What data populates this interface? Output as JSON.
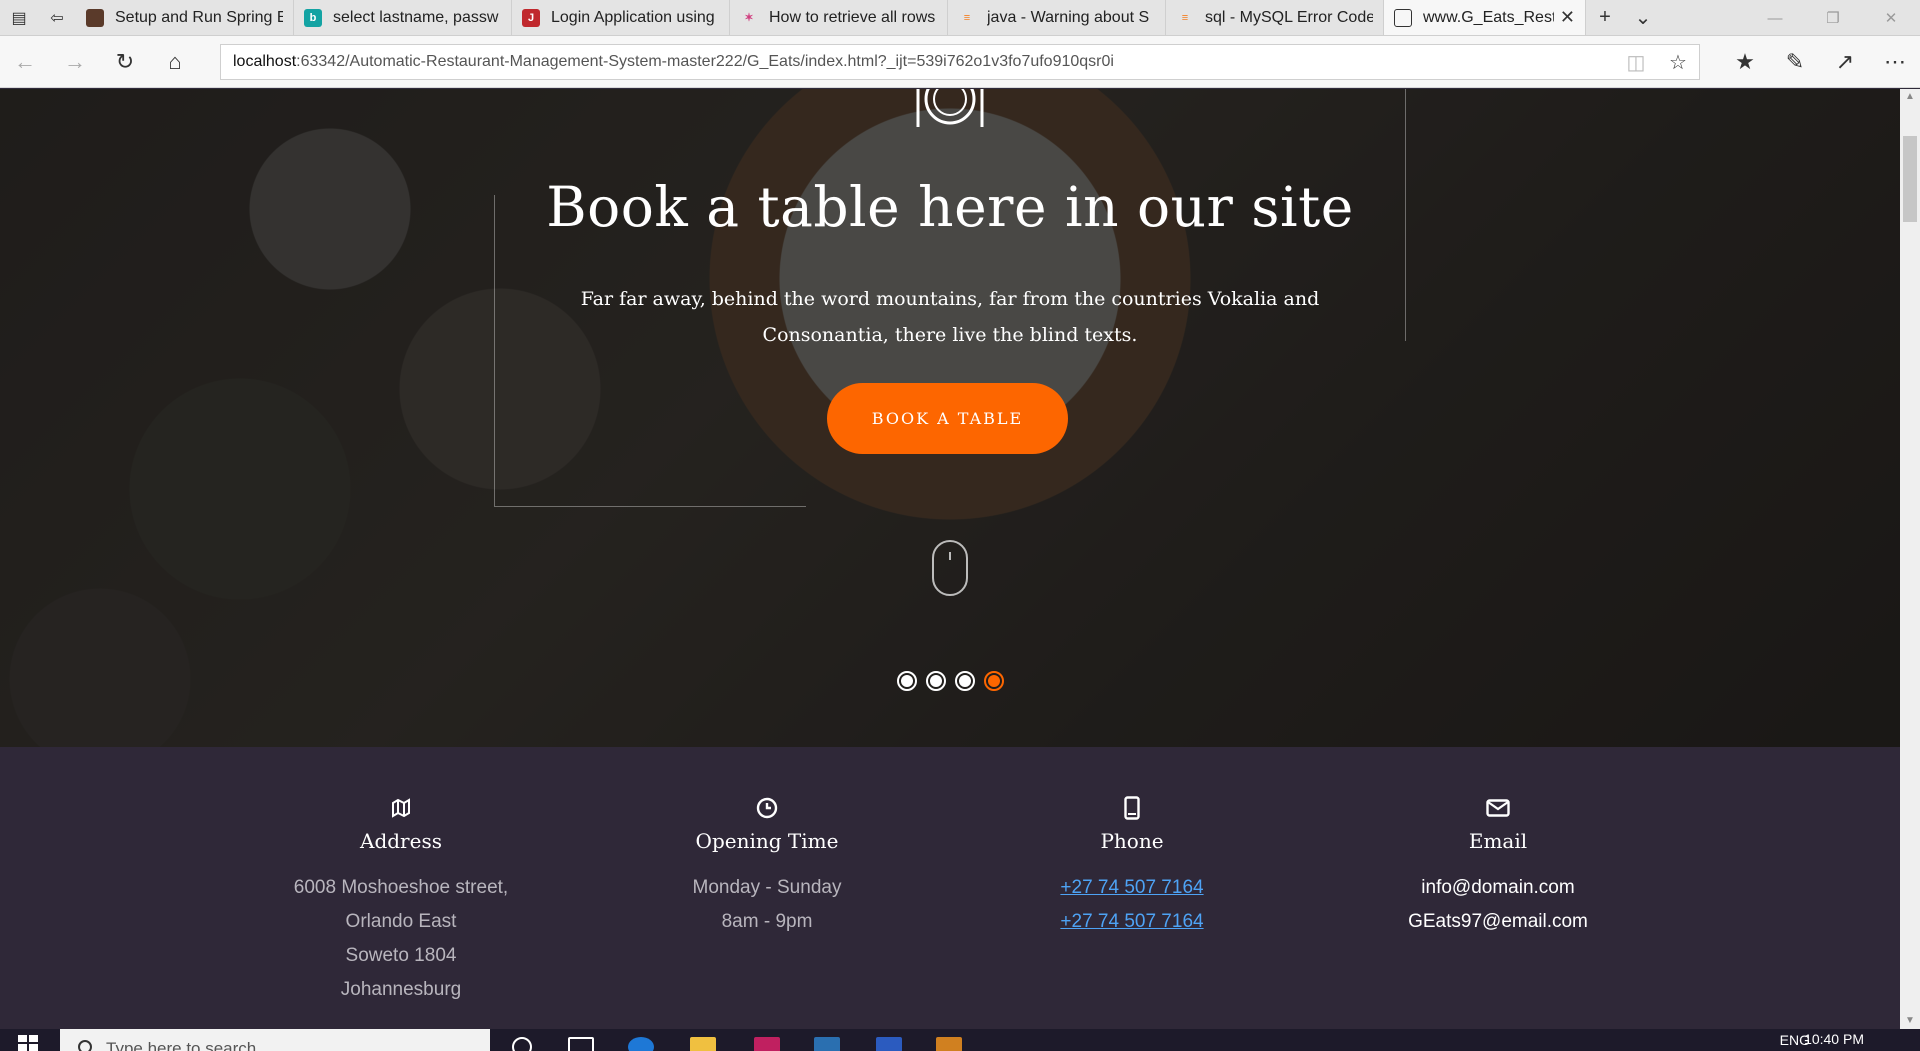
{
  "browser": {
    "tabs": [
      {
        "title": "Setup and Run Spring E",
        "fav_color": "#5a3a2a",
        "fav_glyph": ""
      },
      {
        "title": "select lastname, passw",
        "fav_color": "#13a3a3",
        "fav_glyph": "b"
      },
      {
        "title": "Login Application using",
        "fav_color": "#c0282d",
        "fav_glyph": "J"
      },
      {
        "title": "How to retrieve all rows",
        "fav_color": "#e8e8e8",
        "fav_glyph": "✶"
      },
      {
        "title": "java - Warning about S",
        "fav_color": "#f48024",
        "fav_glyph": "≡"
      },
      {
        "title": "sql - MySQL Error Code",
        "fav_color": "#f48024",
        "fav_glyph": "≡"
      }
    ],
    "active_tab": {
      "title": "www.G_Eats_Restau"
    },
    "url_host": "localhost",
    "url_rest": ":63342/Automatic-Restaurant-Management-System-master222/G_Eats/index.html?_ijt=539i762o1v3fo7ufo910qsr0i"
  },
  "hero": {
    "title": "Book a table here in our site",
    "subtitle": "Far far away, behind the word mountains, far from the countries Vokalia and Consonantia, there live the blind texts.",
    "button_label": "BOOK A TABLE",
    "slides_count": 4,
    "active_slide": 4,
    "accent_color": "#fd6600"
  },
  "info": {
    "address": {
      "icon": "map-icon",
      "heading": "Address",
      "lines": [
        "6008 Moshoeshoe street,",
        "Orlando East",
        "Soweto 1804",
        "Johannesburg"
      ]
    },
    "hours": {
      "icon": "clock-icon",
      "heading": "Opening Time",
      "lines": [
        "Monday - Sunday",
        "8am - 9pm"
      ]
    },
    "phone": {
      "icon": "phone-icon",
      "heading": "Phone",
      "lines": [
        "+27 74 507 7164",
        "+27 74 507 7164"
      ]
    },
    "email": {
      "icon": "mail-icon",
      "heading": "Email",
      "lines": [
        "info@domain.com",
        "GEats97@email.com"
      ]
    }
  },
  "taskbar": {
    "search_placeholder": "Type here to search",
    "lang": "ENG",
    "time": "10:40 PM"
  }
}
